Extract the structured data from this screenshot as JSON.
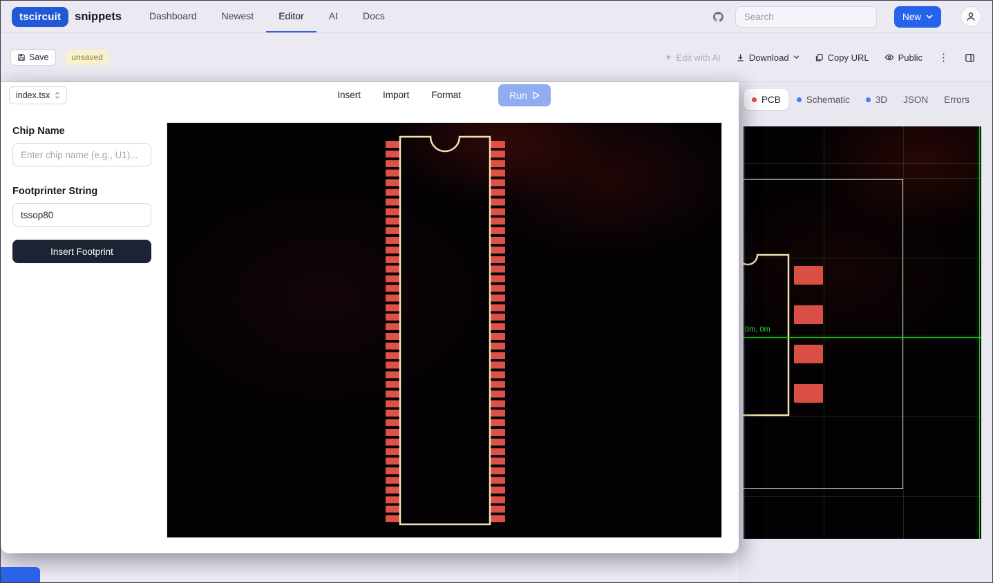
{
  "navbar": {
    "logo_text": "tscircuit",
    "brand_text": "snippets",
    "links": [
      {
        "label": "Dashboard",
        "active": false
      },
      {
        "label": "Newest",
        "active": false
      },
      {
        "label": "Editor",
        "active": true
      },
      {
        "label": "AI",
        "active": false
      },
      {
        "label": "Docs",
        "active": false
      }
    ],
    "search": {
      "placeholder": "Search"
    },
    "new_button_label": "New"
  },
  "savebar": {
    "save_label": "Save",
    "unsaved_badge": "unsaved",
    "edit_with_ai_label": "Edit with AI",
    "download_label": "Download",
    "copy_url_label": "Copy URL",
    "public_label": "Public",
    "kebab_glyph": "⋮"
  },
  "editor_header": {
    "file_name": "index.tsx",
    "insert_label": "Insert",
    "import_label": "Import",
    "format_label": "Format",
    "run_label": "Run"
  },
  "preview_tabs": [
    {
      "label": "PCB",
      "dot_color": "#ef4444",
      "active": true
    },
    {
      "label": "Schematic",
      "dot_color": "#3b82f6",
      "active": false
    },
    {
      "label": "3D",
      "dot_color": "#3b82f6",
      "active": false
    },
    {
      "label": "JSON",
      "dot_color": null,
      "active": false
    },
    {
      "label": "Errors",
      "dot_color": null,
      "active": false
    }
  ],
  "insert_dialog": {
    "chip_name_label": "Chip Name",
    "chip_name_placeholder": "Enter chip name (e.g., U1)...",
    "footprint_label": "Footprinter String",
    "footprint_value": "tssop80",
    "insert_button_label": "Insert Footprint",
    "footprint_preview": {
      "type": "tssop",
      "pins": 80,
      "pins_per_side": 40
    }
  },
  "pcb_view": {
    "origin_label": "0m, 0m",
    "visible_right_pads": 4
  },
  "colors": {
    "accent_blue": "#2563eb",
    "logo_blue": "#2158d6",
    "pad_red": "#dd5146",
    "silkscreen_cream": "#efe3b0",
    "grid_green": "#2d962d",
    "origin_green": "#27e327",
    "unsaved_bg": "#f7f1cd",
    "dark_button": "#1c2333"
  }
}
